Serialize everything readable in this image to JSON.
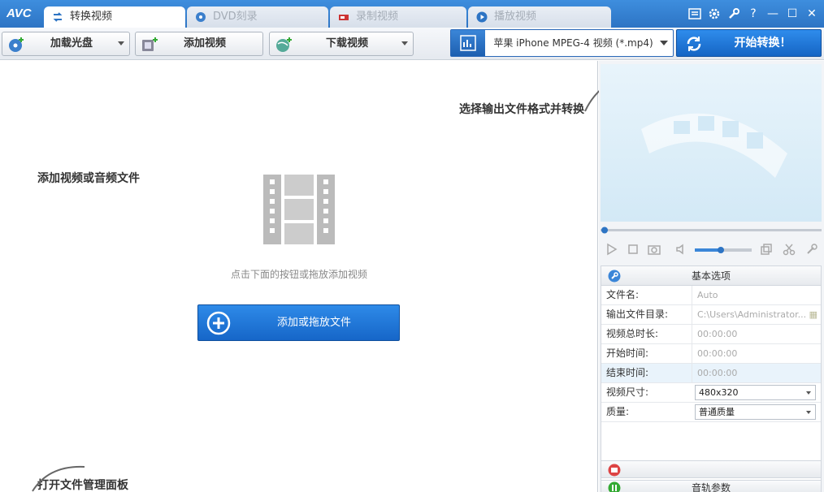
{
  "app": {
    "logo": "AVC"
  },
  "tabs": [
    {
      "label": "转换视频",
      "icon": "convert-icon",
      "active": true
    },
    {
      "label": "DVD刻录",
      "icon": "disc-icon",
      "active": false
    },
    {
      "label": "录制视频",
      "icon": "record-icon",
      "active": false
    },
    {
      "label": "播放视频",
      "icon": "play-icon",
      "active": false
    }
  ],
  "window": {
    "help": "?",
    "minimize": "—",
    "maximize": "☐",
    "close": "✕"
  },
  "toolbar": {
    "load_disc": "加载光盘",
    "add_video": "添加视频",
    "download_video": "下载视频"
  },
  "format": {
    "selected": "苹果 iPhone MPEG-4 视频 (*.mp4)"
  },
  "convert": {
    "label": "开始转换！"
  },
  "main": {
    "hint_add": "添加视频或音频文件",
    "hint_format": "选择输出文件格式并转换",
    "hint_panel": "打开文件管理面板",
    "drop_hint": "点击下面的按钮或拖放添加视频",
    "add_button": "添加或拖放文件"
  },
  "props": {
    "header": "基本选项",
    "rows": [
      {
        "key": "文件名:",
        "value": "Auto"
      },
      {
        "key": "输出文件目录:",
        "value": "C:\\Users\\Administrator..."
      },
      {
        "key": "视频总时长:",
        "value": "00:00:00"
      },
      {
        "key": "开始时间:",
        "value": "00:00:00"
      },
      {
        "key": "结束时间:",
        "value": "00:00:00"
      },
      {
        "key": "视频尺寸:",
        "value": "480x320"
      },
      {
        "key": "质量:",
        "value": "普通质量"
      }
    ],
    "footer": "音轨参数"
  },
  "colors": {
    "accent": "#1e73d4",
    "titlebar": "#3e8ede"
  }
}
